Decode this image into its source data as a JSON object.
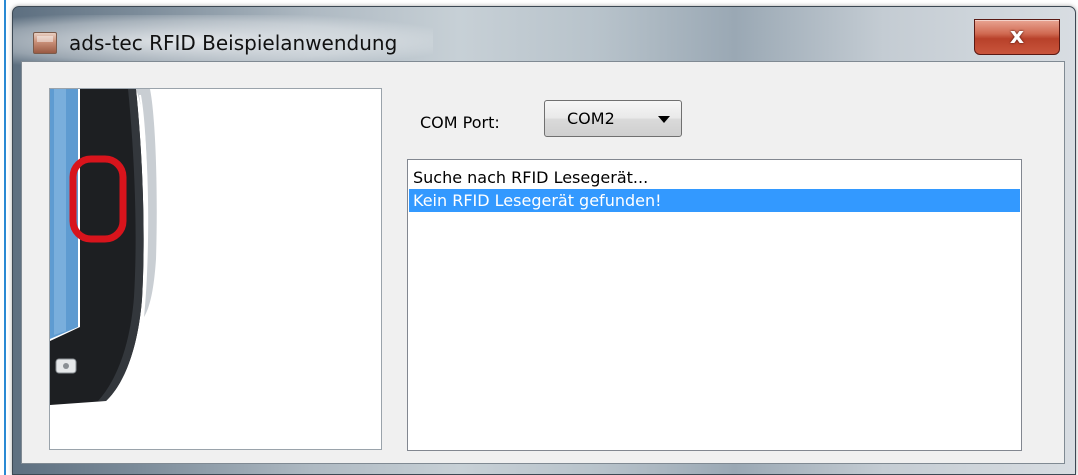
{
  "window": {
    "title": "ads-tec RFID Beispielanwendung",
    "close_glyph": "x",
    "icon": "app-icon"
  },
  "form": {
    "com_port_label": "COM Port:",
    "com_port_value": "COM2",
    "com_port_icon": "chevron-down-icon"
  },
  "log": {
    "items": [
      {
        "text": "Suche nach RFID Lesegerät...",
        "selected": false
      },
      {
        "text": "Kein RFID Lesegerät gefunden!",
        "selected": true
      }
    ]
  },
  "device_image": {
    "icons": [
      "device-illustration",
      "rfid-reader-highlight",
      "camera-icon"
    ],
    "colors": {
      "highlight": "#d8141c",
      "screen": "#5e9bd1",
      "body": "#1d1f22"
    }
  },
  "colors": {
    "selection": "#3399ff",
    "close_button": "#c9553c",
    "edge_line": "#2a8ad4"
  }
}
